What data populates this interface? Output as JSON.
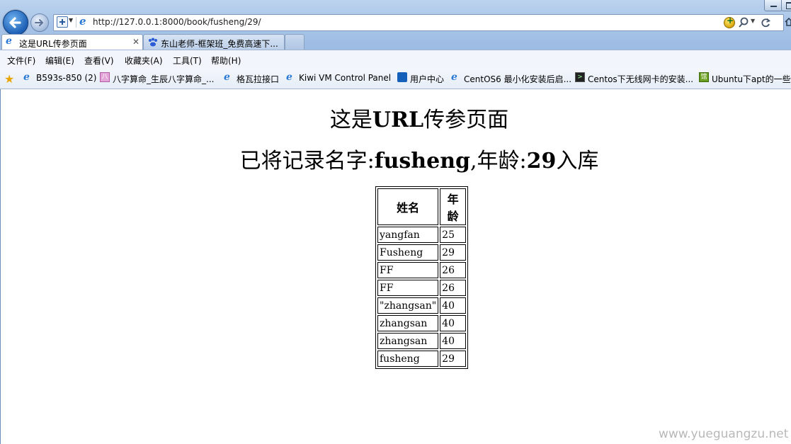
{
  "address_bar": {
    "url": "http://127.0.0.1:8000/book/fusheng/29/"
  },
  "tabs": [
    {
      "label": "这是URL传参页面",
      "active": true
    },
    {
      "label": "东山老师-框架班_免费高速下...",
      "active": false
    }
  ],
  "menu": [
    "文件(F)",
    "编辑(E)",
    "查看(V)",
    "收藏夹(A)",
    "工具(T)",
    "帮助(H)"
  ],
  "favorites": [
    {
      "label": "B593s-850 (2)",
      "icon": "ie-icon"
    },
    {
      "label": "八字算命_生辰八字算命_...",
      "icon": "pink-page-icon"
    },
    {
      "label": "格瓦拉接口",
      "icon": "ie-icon"
    },
    {
      "label": "Kiwi VM Control Panel",
      "icon": "ie-icon"
    },
    {
      "label": "用户中心",
      "icon": "telecom-icon"
    },
    {
      "label": "CentOS6 最小化安装后启...",
      "icon": "ie-icon"
    },
    {
      "label": "Centos下无线网卡的安装...",
      "icon": "terminal-icon"
    },
    {
      "label": "Ubuntu下apt的一些用",
      "icon": "green-book-icon"
    }
  ],
  "page": {
    "title_prefix": "这是",
    "title_bold": "URL",
    "title_suffix": "传参页面",
    "record_prefix": "已将记录名字:",
    "record_name": "fusheng",
    "record_mid": ",年龄:",
    "record_age": "29",
    "record_suffix": "入库",
    "table_headers": [
      "姓名",
      "年龄"
    ],
    "rows": [
      [
        "yangfan",
        "25"
      ],
      [
        "Fusheng",
        "29"
      ],
      [
        "FF",
        "26"
      ],
      [
        "FF",
        "26"
      ],
      [
        "\"zhangsan\"",
        "40"
      ],
      [
        "zhangsan",
        "40"
      ],
      [
        "zhangsan",
        "40"
      ],
      [
        "fusheng",
        "29"
      ]
    ]
  },
  "watermark": "www.yueguangzu.net"
}
